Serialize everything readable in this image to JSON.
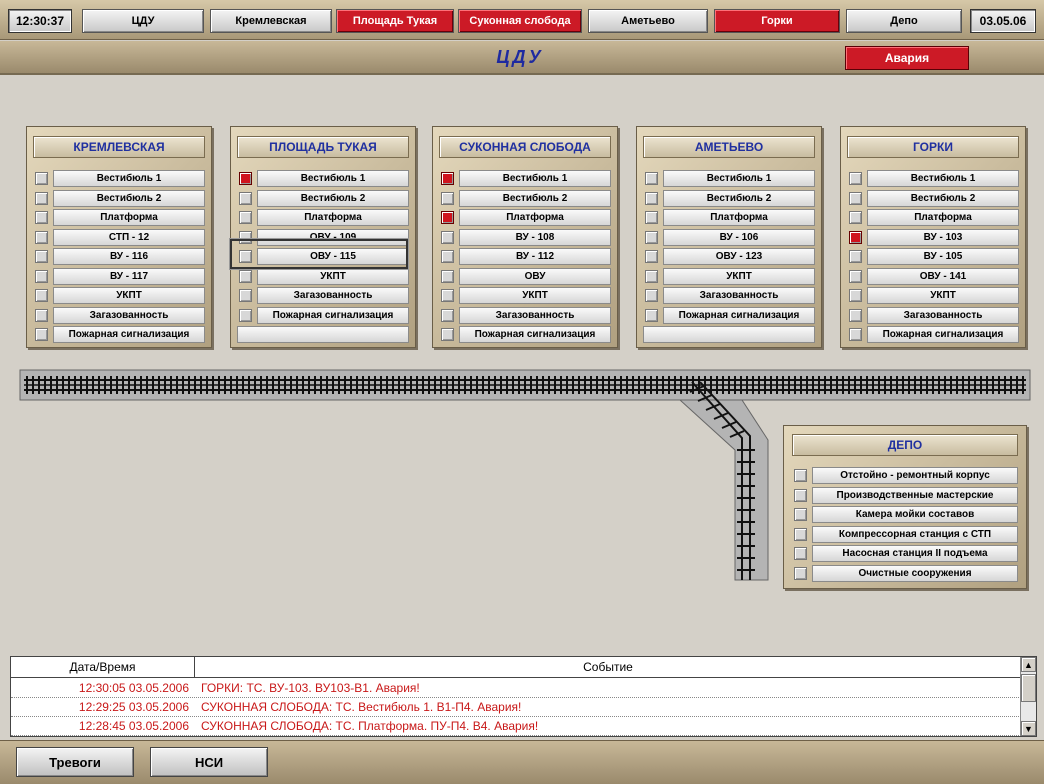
{
  "header": {
    "time": "12:30:37",
    "date": "03.05.06",
    "tabs": [
      {
        "label": "ЦДУ",
        "alarm": false
      },
      {
        "label": "Кремлевская",
        "alarm": false
      },
      {
        "label": "Площадь Тукая",
        "alarm": true
      },
      {
        "label": "Суконная слобода",
        "alarm": true
      },
      {
        "label": "Аметьево",
        "alarm": false
      },
      {
        "label": "Горки",
        "alarm": true
      },
      {
        "label": "Депо",
        "alarm": false
      }
    ]
  },
  "title": {
    "text": "ЦДУ",
    "alarm_label": "Авария"
  },
  "stations": [
    {
      "name": "КРЕМЛЕВСКАЯ",
      "items": [
        {
          "label": "Вестибюль 1",
          "alarm": false
        },
        {
          "label": "Вестибюль 2",
          "alarm": false
        },
        {
          "label": "Платформа",
          "alarm": false
        },
        {
          "label": "СТП - 12",
          "alarm": false
        },
        {
          "label": "ВУ - 116",
          "alarm": false
        },
        {
          "label": "ВУ - 117",
          "alarm": false
        },
        {
          "label": "УКПТ",
          "alarm": false
        },
        {
          "label": "Загазованность",
          "alarm": false
        },
        {
          "label": "Пожарная сигнализация",
          "alarm": false
        }
      ]
    },
    {
      "name": "ПЛОЩАДЬ ТУКАЯ",
      "items": [
        {
          "label": "Вестибюль 1",
          "alarm": true
        },
        {
          "label": "Вестибюль 2",
          "alarm": false
        },
        {
          "label": "Платформа",
          "alarm": false
        },
        {
          "label": "ОВУ - 109",
          "alarm": false
        },
        {
          "label": "ОВУ - 115",
          "alarm": false
        },
        {
          "label": "УКПТ",
          "alarm": false
        },
        {
          "label": "Загазованность",
          "alarm": false
        },
        {
          "label": "Пожарная сигнализация",
          "alarm": false
        },
        {
          "label": "",
          "alarm": false
        }
      ]
    },
    {
      "name": "СУКОННАЯ СЛОБОДА",
      "items": [
        {
          "label": "Вестибюль 1",
          "alarm": true
        },
        {
          "label": "Вестибюль 2",
          "alarm": false
        },
        {
          "label": "Платформа",
          "alarm": true
        },
        {
          "label": "ВУ - 108",
          "alarm": false
        },
        {
          "label": "ВУ - 112",
          "alarm": false
        },
        {
          "label": "ОВУ",
          "alarm": false
        },
        {
          "label": "УКПТ",
          "alarm": false
        },
        {
          "label": "Загазованность",
          "alarm": false
        },
        {
          "label": "Пожарная сигнализация",
          "alarm": false
        }
      ]
    },
    {
      "name": "АМЕТЬЕВО",
      "items": [
        {
          "label": "Вестибюль 1",
          "alarm": false
        },
        {
          "label": "Вестибюль 2",
          "alarm": false
        },
        {
          "label": "Платформа",
          "alarm": false
        },
        {
          "label": "ВУ - 106",
          "alarm": false
        },
        {
          "label": "ОВУ - 123",
          "alarm": false
        },
        {
          "label": "УКПТ",
          "alarm": false
        },
        {
          "label": "Загазованность",
          "alarm": false
        },
        {
          "label": "Пожарная сигнализация",
          "alarm": false
        },
        {
          "label": "",
          "alarm": false
        }
      ]
    },
    {
      "name": "ГОРКИ",
      "items": [
        {
          "label": "Вестибюль 1",
          "alarm": false
        },
        {
          "label": "Вестибюль 2",
          "alarm": false
        },
        {
          "label": "Платформа",
          "alarm": false
        },
        {
          "label": "ВУ - 103",
          "alarm": true
        },
        {
          "label": "ВУ - 105",
          "alarm": false
        },
        {
          "label": "ОВУ - 141",
          "alarm": false
        },
        {
          "label": "УКПТ",
          "alarm": false
        },
        {
          "label": "Загазованность",
          "alarm": false
        },
        {
          "label": "Пожарная сигнализация",
          "alarm": false
        }
      ]
    }
  ],
  "depot": {
    "name": "ДЕПО",
    "items": [
      {
        "label": "Отстойно - ремонтный корпус",
        "alarm": false
      },
      {
        "label": "Производственные мастерские",
        "alarm": false
      },
      {
        "label": "Камера мойки составов",
        "alarm": false
      },
      {
        "label": "Компрессорная станция с СТП",
        "alarm": false
      },
      {
        "label": "Насосная станция II подъема",
        "alarm": false
      },
      {
        "label": "Очистные сооружения",
        "alarm": false
      }
    ]
  },
  "log": {
    "col_time": "Дата/Время",
    "col_event": "Событие",
    "rows": [
      {
        "time": "12:30:05  03.05.2006",
        "event": "ГОРКИ: ТС. ВУ-103. ВУ103-В1. Авария!"
      },
      {
        "time": "12:29:25  03.05.2006",
        "event": "СУКОННАЯ СЛОБОДА: ТС. Вестибюль 1. В1-П4. Авария!"
      },
      {
        "time": "12:28:45  03.05.2006",
        "event": "СУКОННАЯ СЛОБОДА: ТС. Платформа. ПУ-П4. В4. Авария!"
      }
    ]
  },
  "footer": {
    "alarms_label": "Тревоги",
    "nsi_label": "НСИ"
  },
  "colors": {
    "alarm": "#cc1a26",
    "title": "#1e2aa0",
    "log_text": "#c81818"
  }
}
